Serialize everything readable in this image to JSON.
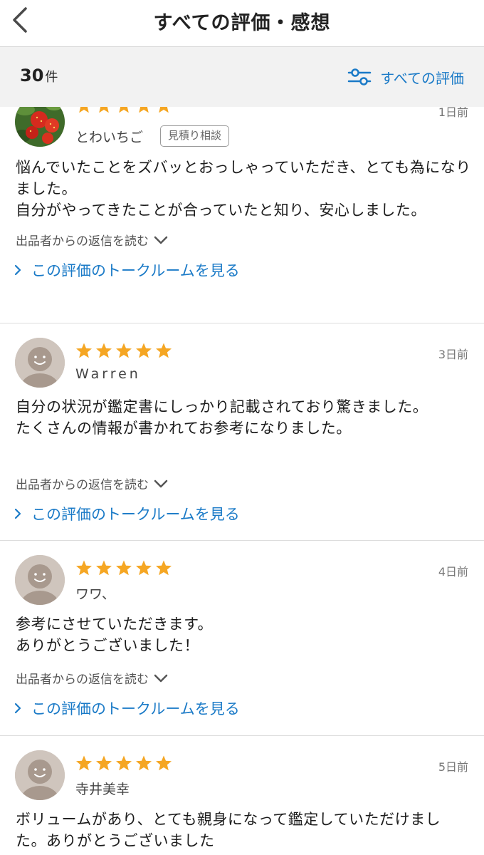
{
  "header": {
    "title": "すべての評価・感想"
  },
  "summary": {
    "count": "30",
    "count_unit": "件",
    "filter_label": "すべての評価"
  },
  "colors": {
    "star": "#f5a623",
    "link": "#1a7ac7"
  },
  "reviews": [
    {
      "rating": 5,
      "date": "1日前",
      "user": "とわいちご",
      "badge": "見積り相談",
      "avatar": "strawberry-photo",
      "body": "悩んでいたことをズバッとおっしゃっていただき、とても為になりました。\n自分がやってきたことが合っていたと知り、安心しました。",
      "reply_label": "出品者からの返信を読む",
      "talk_label": "この評価のトークルームを見る"
    },
    {
      "rating": 5,
      "date": "3日前",
      "user": "Warren",
      "avatar": "default-avatar",
      "body": "自分の状況が鑑定書にしっかり記載されており驚きました。\nたくさんの情報が書かれてお参考になりました。",
      "reply_label": "出品者からの返信を読む",
      "talk_label": "この評価のトークルームを見る"
    },
    {
      "rating": 5,
      "date": "4日前",
      "user": "ワワ、",
      "avatar": "default-avatar",
      "body": "参考にさせていただきます。\nありがとうございました！",
      "reply_label": "出品者からの返信を読む",
      "talk_label": "この評価のトークルームを見る"
    },
    {
      "rating": 5,
      "date": "5日前",
      "user": "寺井美幸",
      "avatar": "default-avatar",
      "body": "ボリュームがあり、とても親身になって鑑定していただけました。ありがとうございました"
    }
  ]
}
